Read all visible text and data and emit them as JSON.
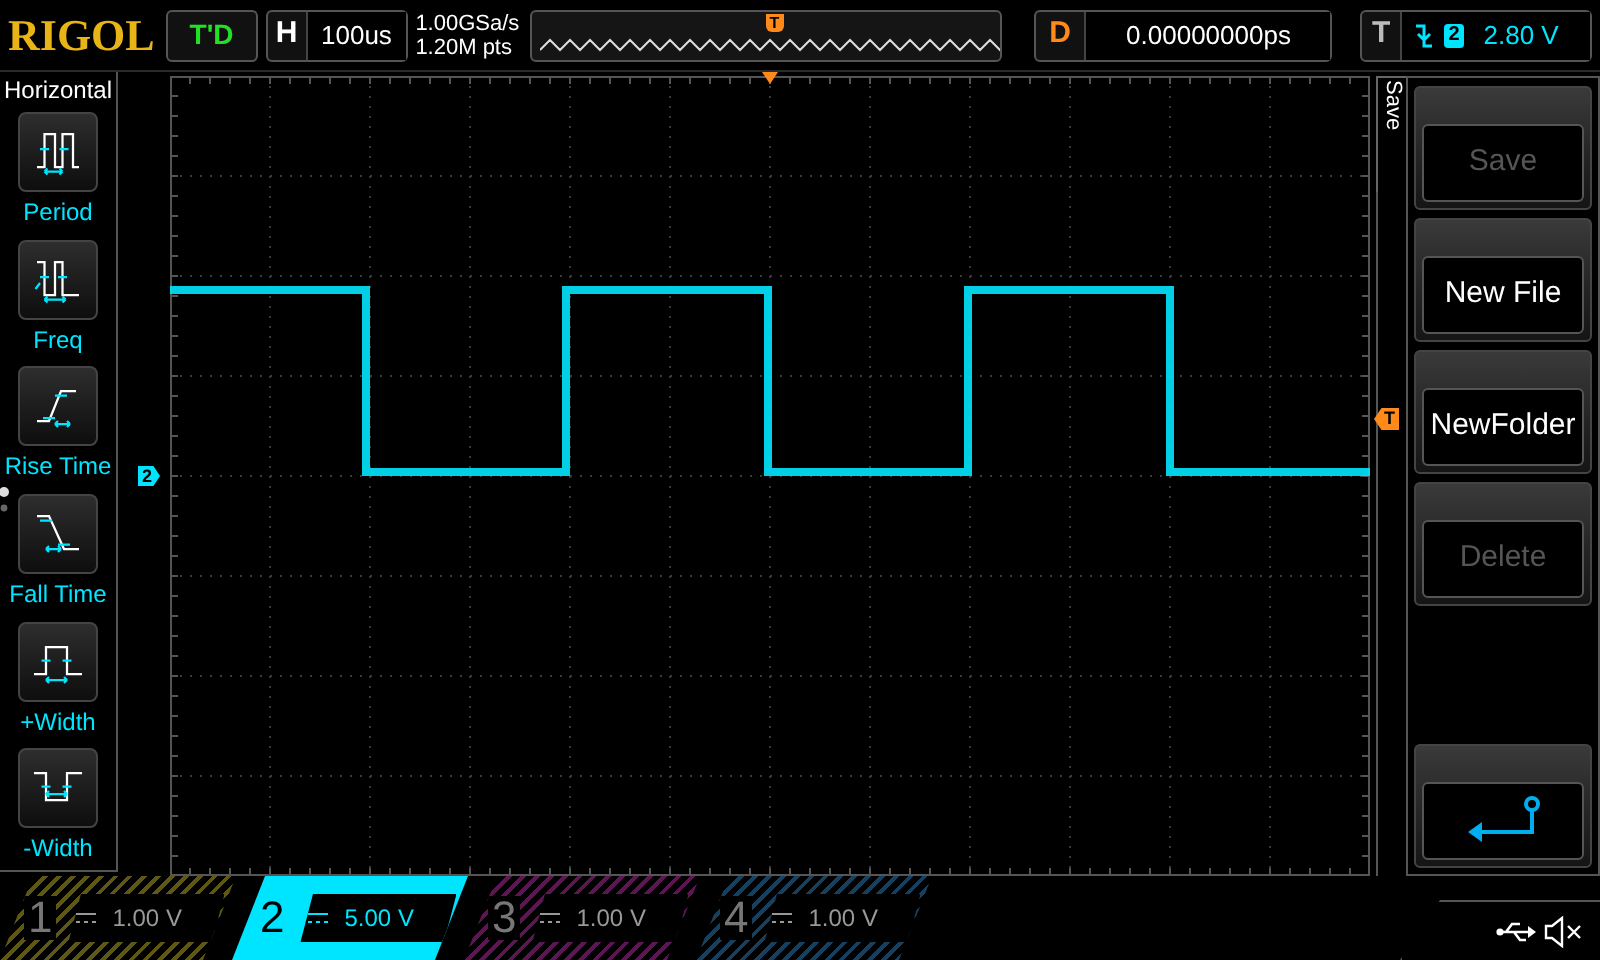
{
  "brand": "RIGOL",
  "run_status": "T'D",
  "horizontal": {
    "label": "H",
    "timebase": "100us"
  },
  "sample_rate": "1.00GSa/s",
  "memory_depth": "1.20M pts",
  "timeline": {
    "marker": "T"
  },
  "delay": {
    "label": "D",
    "value": "0.00000000ps"
  },
  "trigger": {
    "label": "T",
    "source": "2",
    "level": "2.80 V"
  },
  "left_menu": {
    "title": "Horizontal",
    "items": [
      {
        "label": "Period",
        "kind": "period"
      },
      {
        "label": "Freq",
        "kind": "freq"
      },
      {
        "label": "Rise Time",
        "kind": "rise"
      },
      {
        "label": "Fall Time",
        "kind": "fall"
      },
      {
        "label": "+Width",
        "kind": "pwidth"
      },
      {
        "label": "-Width",
        "kind": "nwidth"
      }
    ]
  },
  "markers": {
    "channel": "2",
    "trigger_level": "T"
  },
  "right_menu": {
    "tab": "Save",
    "buttons": [
      {
        "kind": "text",
        "label": "Save",
        "disabled": true
      },
      {
        "kind": "text",
        "label": "New File",
        "disabled": false
      },
      {
        "kind": "text",
        "label": "NewFolder",
        "disabled": false
      },
      {
        "kind": "text",
        "label": "Delete",
        "disabled": true
      },
      {
        "kind": "back"
      }
    ]
  },
  "channels": [
    {
      "number": "1",
      "scale": "1.00 V",
      "selected": false,
      "color": "#5e5812"
    },
    {
      "number": "2",
      "scale": "5.00 V",
      "selected": true,
      "color": "#00e5ff"
    },
    {
      "number": "3",
      "scale": "1.00 V",
      "selected": false,
      "color": "#5c1652"
    },
    {
      "number": "4",
      "scale": "1.00 V",
      "selected": false,
      "color": "#16405e"
    }
  ]
}
